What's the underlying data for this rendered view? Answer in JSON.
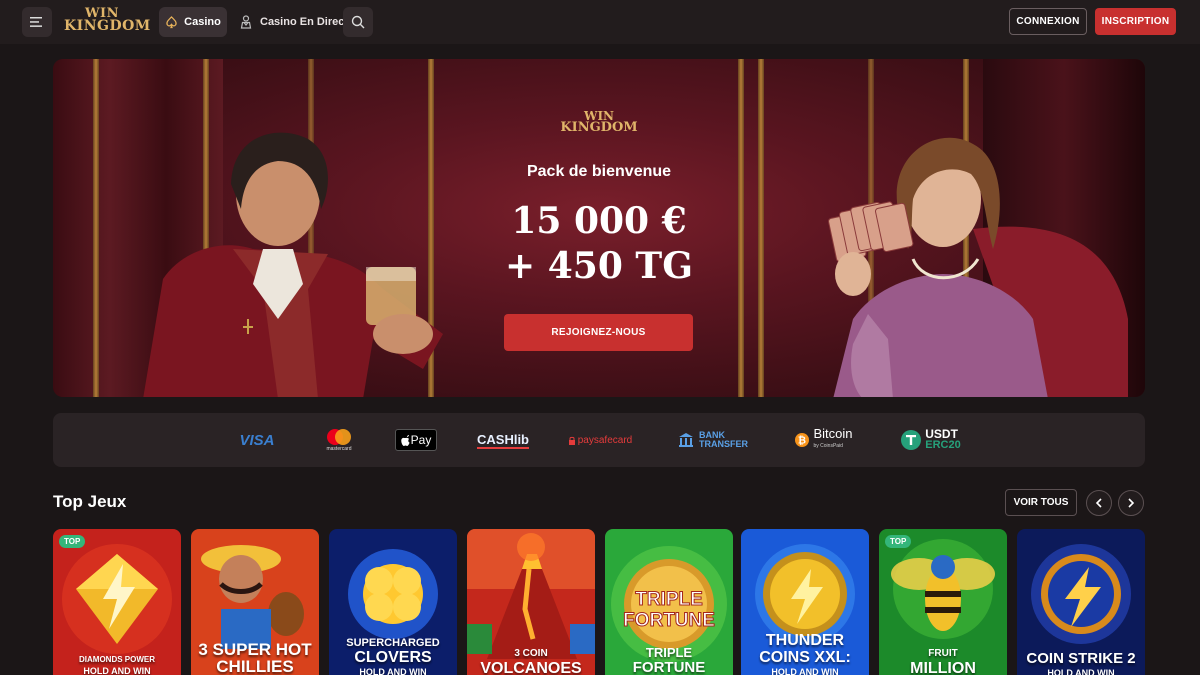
{
  "header": {
    "logo": {
      "line1": "WIN",
      "line2": "KINGDOM"
    },
    "nav": [
      {
        "label": "Casino",
        "icon": "spade-icon",
        "active": true
      },
      {
        "label": "Casino En Direct",
        "icon": "dealer-icon",
        "active": false
      }
    ],
    "login_label": "CONNEXION",
    "signup_label": "INSCRIPTION",
    "accent": "#c8302f"
  },
  "hero": {
    "logo": {
      "line1": "WIN",
      "line2": "KINGDOM"
    },
    "subtitle": "Pack de bienvenue",
    "amount_line1": "15 000 €",
    "amount_line2": "+ 450 TG",
    "cta": "REJOIGNEZ-NOUS"
  },
  "payments": [
    {
      "label": "VISA"
    },
    {
      "label": "mastercard"
    },
    {
      "label": "Pay"
    },
    {
      "label": "CASHlib"
    },
    {
      "label": "paysafecard"
    },
    {
      "label": "BANK",
      "label2": "TRANSFER"
    },
    {
      "label": "Bitcoin",
      "label2": "by CoinsPaid"
    },
    {
      "label": "USDT",
      "label2": "ERC20"
    }
  ],
  "top_games": {
    "title": "Top Jeux",
    "view_all": "VOIR TOUS",
    "badge": "TOP",
    "games": [
      {
        "line1": "DIAMONDS POWER",
        "line2": "HOLD AND WIN",
        "top": true
      },
      {
        "line1": "3 SUPER HOT",
        "line2": "CHILLIES",
        "top": false
      },
      {
        "line1": "SUPERCHARGED",
        "line2": "CLOVERS",
        "line3": "HOLD AND WIN",
        "top": false
      },
      {
        "line1": "3 COIN",
        "line2": "VOLCANOES",
        "top": false
      },
      {
        "line1": "TRIPLE",
        "line2": "FORTUNE",
        "top": false
      },
      {
        "line1": "THUNDER",
        "line2": "COINS XXL:",
        "line3": "HOLD AND WIN",
        "top": false
      },
      {
        "line1": "FRUIT",
        "line2": "MILLION",
        "top": true
      },
      {
        "line1": "COIN STRIKE 2",
        "line2": "HOLD AND WIN",
        "top": false
      }
    ]
  }
}
